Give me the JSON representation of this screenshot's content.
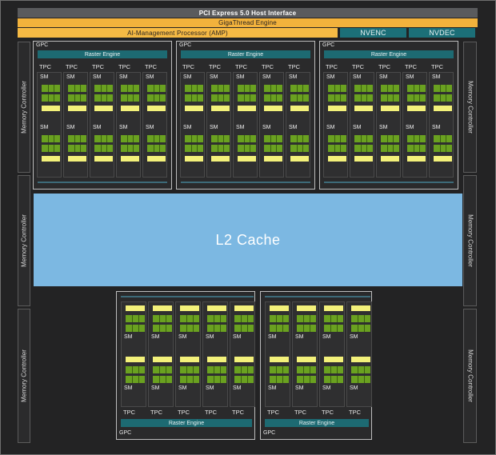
{
  "diagram": {
    "host_interface": "PCI Express 5.0 Host Interface",
    "gigathread": "GigaThread Engine",
    "amp": "AI-Management Processor (AMP)",
    "nvenc": "NVENC",
    "nvdec": "NVDEC",
    "l2_cache": "L2 Cache",
    "memory_controller": "Memory Controller",
    "gpc_label": "GPC",
    "raster_engine": "Raster Engine",
    "tpc_label": "TPC",
    "sm_label": "SM",
    "top_gpcs": [
      {
        "tpcs": 5
      },
      {
        "tpcs": 5
      },
      {
        "tpcs": 5
      }
    ],
    "bottom_gpcs": [
      {
        "tpcs": 5
      },
      {
        "tpcs": 4
      }
    ]
  },
  "colors": {
    "die_background": "#232324",
    "pcie_bar": "#5a5b5d",
    "gigathread_bar": "#f2b23c",
    "amp_bar": "#f6ba44",
    "nvenc_nvdec": "#1c6f78",
    "l2_cache": "#7cb8e2",
    "raster_engine": "#1d6a72",
    "cuda_cores": "#6aa120",
    "tensor_units": "#f3f17a"
  }
}
